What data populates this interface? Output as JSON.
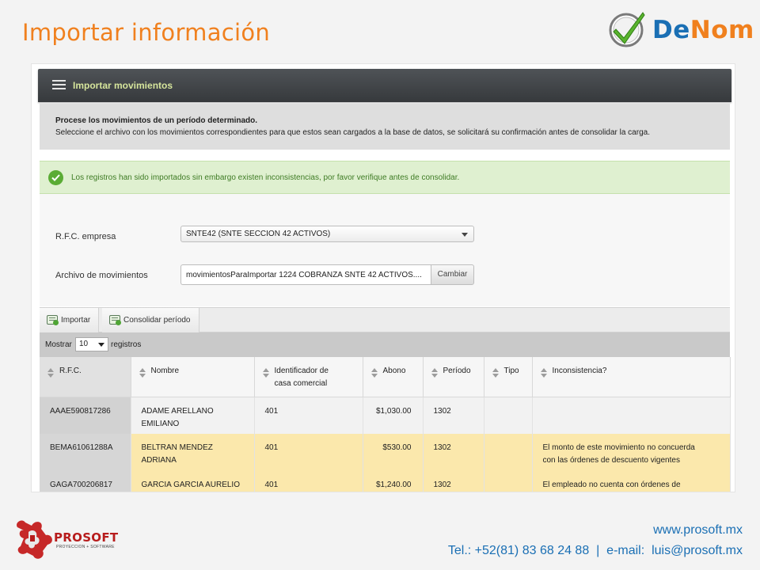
{
  "slide": {
    "title": "Importar información",
    "brand_logo": {
      "text_a": "De",
      "text_b": "Nom"
    }
  },
  "app": {
    "header_title": "Importar movimientos",
    "info": {
      "line1": "Procese los movimientos de un período determinado.",
      "line2": "Seleccione el archivo con los movimientos correspondientes para que estos sean cargados a la base de datos, se solicitará su confirmación antes de consolidar la carga."
    },
    "alert": "Los registros han sido importados sin embargo existen inconsistencias, por favor verifique antes de consolidar.",
    "form": {
      "rfc_label": "R.F.C. empresa",
      "rfc_value": "SNTE42 (SNTE SECCION 42 ACTIVOS)",
      "file_label": "Archivo de movimientos",
      "file_value": "movimientosParaImportar 1224 COBRANZA SNTE 42 ACTIVOS....",
      "file_button": "Cambiar"
    },
    "toolbar": {
      "import_label": "Importar",
      "consolidate_label": "Consolidar período"
    },
    "length": {
      "prefix": "Mostrar",
      "value": "10",
      "suffix": "registros"
    },
    "table": {
      "headers": {
        "rfc": "R.F.C.",
        "nombre": "Nombre",
        "ident_line1": "Identificador de",
        "ident_line2": "casa comercial",
        "abono": "Abono",
        "periodo": "Período",
        "tipo": "Tipo",
        "inconsistencia": "Inconsistencia?"
      },
      "rows": [
        {
          "rfc": "AAAE590817286",
          "nombre_l1": "ADAME ARELLANO",
          "nombre_l2": "EMILIANO",
          "ident": "401",
          "abono": "$1,030.00",
          "periodo": "1302",
          "tipo": "",
          "incons_l1": "",
          "incons_l2": ""
        },
        {
          "rfc": "BEMA61061288A",
          "nombre_l1": "BELTRAN MENDEZ",
          "nombre_l2": "ADRIANA",
          "ident": "401",
          "abono": "$530.00",
          "periodo": "1302",
          "tipo": "",
          "incons_l1": "El monto de este movimiento no concuerda",
          "incons_l2": "con las órdenes de descuento vigentes"
        },
        {
          "rfc": "GAGA700206817",
          "nombre_l1": "GARCIA GARCIA AURELIO",
          "nombre_l2": "",
          "ident": "401",
          "abono": "$1,240.00",
          "periodo": "1302",
          "tipo": "",
          "incons_l1": "El empleado no cuenta con órdenes de",
          "incons_l2": ""
        }
      ]
    }
  },
  "footer": {
    "url": "www.prosoft.mx",
    "contact": "Tel.: +52(81) 83 68 24 88  |  e-mail:  luis@prosoft.mx",
    "prosoft_name": "PROSOFT",
    "prosoft_tagline": "PROYECCION + SOFTWARE"
  }
}
